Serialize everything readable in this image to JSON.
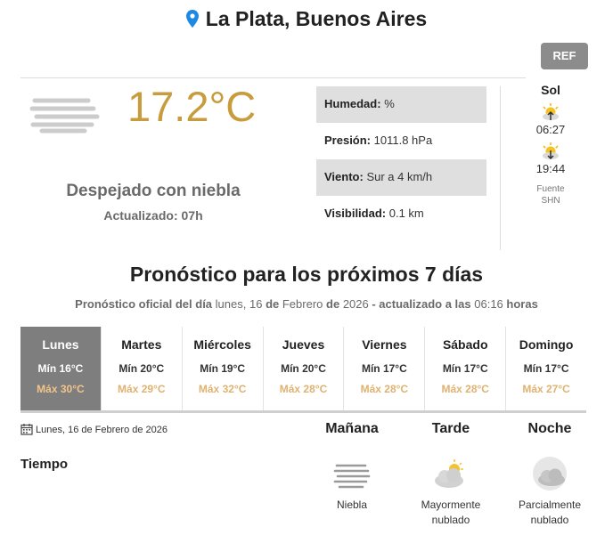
{
  "location": {
    "title": "La Plata, Buenos Aires"
  },
  "ref_button": "REF",
  "current": {
    "temperature": "17.2°C",
    "condition": "Despejado con niebla",
    "updated": "Actualizado: 07h",
    "icon": "fog-icon"
  },
  "stats": {
    "humidity": {
      "label": "Humedad:",
      "value": "%"
    },
    "pressure": {
      "label": "Presión:",
      "value": "1011.8 hPa"
    },
    "wind": {
      "label": "Viento:",
      "value": "Sur a 4 km/h"
    },
    "visibility": {
      "label": "Visibilidad:",
      "value": "0.1 km"
    }
  },
  "sun": {
    "title": "Sol",
    "sunrise": "06:27",
    "sunset": "19:44",
    "source_label": "Fuente",
    "source": "SHN"
  },
  "forecast": {
    "title": "Pronóstico para los próximos 7 días",
    "sub_prefix": "Pronóstico oficial del día",
    "sub_weekday": "lunes, 16",
    "sub_de1": "de",
    "sub_month": "Febrero",
    "sub_de2": "de",
    "sub_year": "2026",
    "sub_mid": "- actualizado a las",
    "sub_time": "06:16",
    "sub_suffix": "horas",
    "days": [
      {
        "name": "Lunes",
        "min": "Mín 16°C",
        "max": "Máx 30°C",
        "active": true
      },
      {
        "name": "Martes",
        "min": "Mín 20°C",
        "max": "Máx 29°C"
      },
      {
        "name": "Miércoles",
        "min": "Mín 19°C",
        "max": "Máx 32°C"
      },
      {
        "name": "Jueves",
        "min": "Mín 20°C",
        "max": "Máx 28°C"
      },
      {
        "name": "Viernes",
        "min": "Mín 17°C",
        "max": "Máx 28°C"
      },
      {
        "name": "Sábado",
        "min": "Mín 17°C",
        "max": "Máx 28°C"
      },
      {
        "name": "Domingo",
        "min": "Mín 17°C",
        "max": "Máx 27°C"
      }
    ]
  },
  "detail": {
    "date": "Lunes, 16 de Febrero de 2026",
    "row_label": "Tiempo",
    "periods": [
      {
        "name": "Mañana",
        "desc": "Niebla",
        "icon": "fog-icon"
      },
      {
        "name": "Tarde",
        "desc": "Mayormente nublado",
        "icon": "mostly-cloudy-icon"
      },
      {
        "name": "Noche",
        "desc": "Parcialmente nublado",
        "icon": "partly-cloudy-night-icon"
      }
    ]
  },
  "colors": {
    "temperature": "#c89c3c",
    "max_temp": "#e0b270",
    "active_day": "#7e7e7e",
    "ref_button": "#8c8c8c",
    "pin": "#1e88e5"
  }
}
